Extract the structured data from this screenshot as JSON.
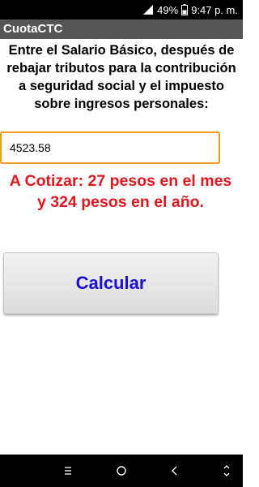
{
  "status_bar": {
    "battery_percent": "49%",
    "time": "9:47 p. m.",
    "icons": [
      "signal-icon",
      "battery-icon"
    ]
  },
  "app": {
    "title": "CuotaCTC"
  },
  "form": {
    "instructions": "Entre el Salario Básico, después de rebajar tributos para la contribución a seguridad social y el impuesto sobre ingresos personales:",
    "input_value": "4523.58",
    "result_text": "A Cotizar: 27 pesos en el mes y 324 pesos en el año.",
    "calculate_label": "Calcular"
  },
  "nav_bar": {
    "icons": [
      "recents-icon",
      "home-icon",
      "back-icon",
      "keyboard-switch-icon"
    ]
  },
  "colors": {
    "title_bar": "#555555",
    "input_border": "#f29a1f",
    "result_text": "#e0171f",
    "button_text": "#1a10d6"
  }
}
